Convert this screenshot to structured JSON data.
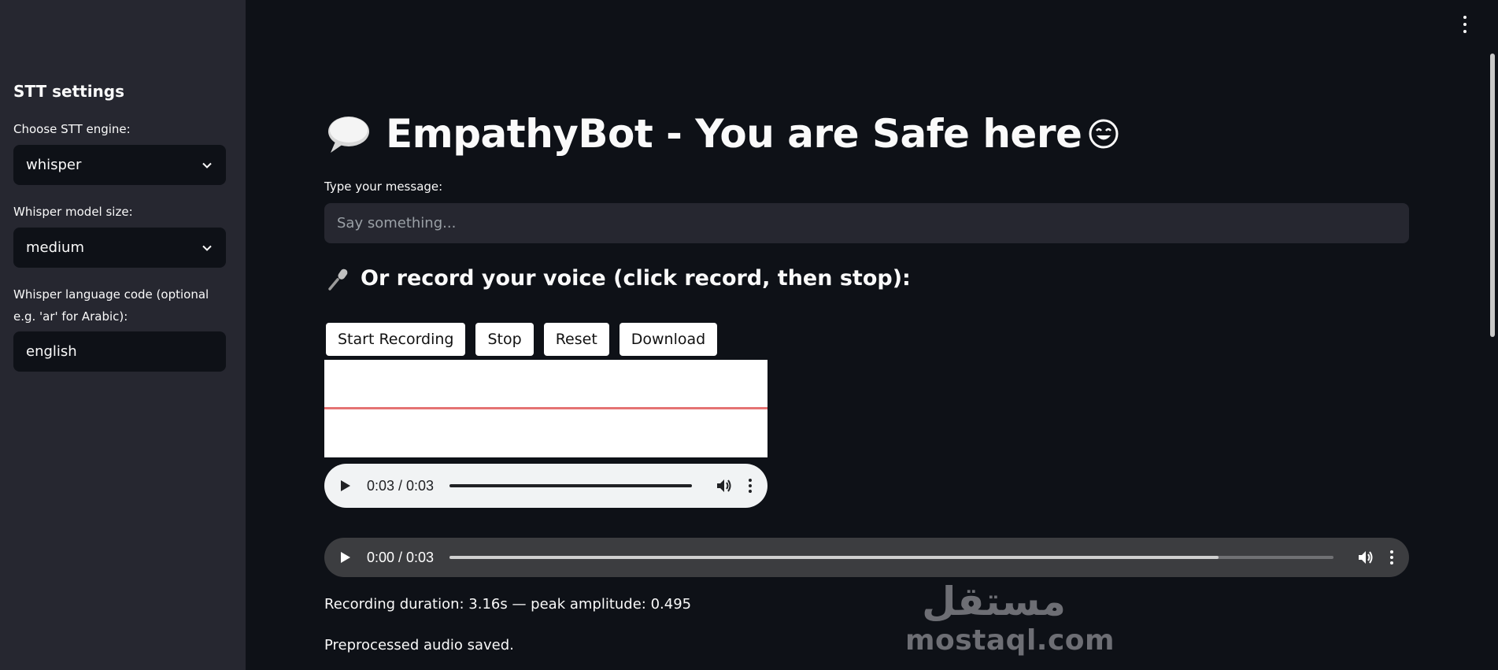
{
  "sidebar": {
    "title": "STT settings",
    "engine_label": "Choose STT engine:",
    "engine_value": "whisper",
    "model_label": "Whisper model size:",
    "model_value": "medium",
    "lang_label_line1": "Whisper language code (optional",
    "lang_label_line2": "e.g. 'ar' for Arabic):",
    "lang_value": "english"
  },
  "main": {
    "title": "EmpathyBot - You are Safe here",
    "message_label": "Type your message:",
    "message_placeholder": "Say something...",
    "record_heading": "Or record your voice (click record, then stop):",
    "buttons": {
      "start": "Start Recording",
      "stop": "Stop",
      "reset": "Reset",
      "download": "Download"
    },
    "player1": {
      "time": "0:03 / 0:03",
      "progress": 1.0
    },
    "player2": {
      "time": "0:00 / 0:03",
      "buffered": 0.87
    },
    "status_duration": "Recording duration: 3.16s — peak amplitude: 0.495",
    "status_saved": "Preprocessed audio saved."
  },
  "watermark": {
    "text": "mostaql.com",
    "arabic": "مستقل"
  },
  "colors": {
    "background": "#0e1117",
    "sidebar": "#262730",
    "input": "#262730",
    "waveform_line": "#e57373"
  }
}
